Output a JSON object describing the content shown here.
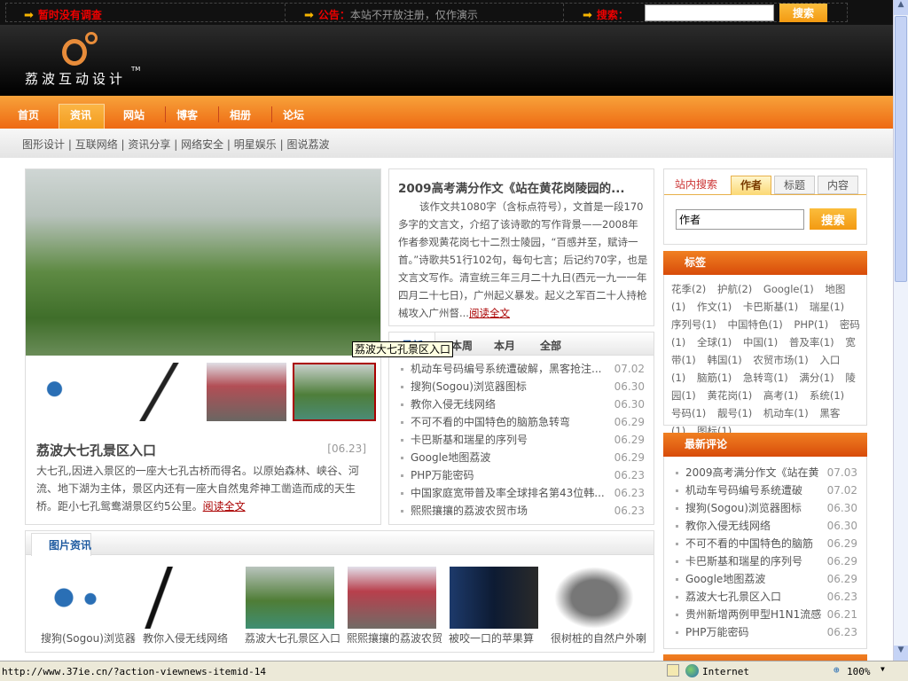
{
  "topbar": {
    "poll": "暂时没有调查",
    "notice_label": "公告：",
    "notice_text": "本站不开放注册，仅作演示",
    "search_label": "搜索：",
    "search_value": "",
    "search_button": "搜索"
  },
  "logo": {
    "text": "荔波互动设计",
    "tm": "TM"
  },
  "nav": [
    "首页",
    "资讯",
    "网站",
    "博客",
    "相册",
    "论坛"
  ],
  "subnav": [
    "图形设计",
    "互联网络",
    "资讯分享",
    "网络安全",
    "明星娱乐",
    "图说荔波"
  ],
  "feature": {
    "title": "荔波大七孔景区入口",
    "date": "[06.23]",
    "text": "大七孔,因进入景区的一座大七孔古桥而得名。以原始森林、峡谷、河流、地下湖为主体，景区内还有一座大自然鬼斧神工凿造而成的天生桥。距小七孔鸳鸯湖景区约5公里。",
    "more": "阅读全文",
    "tooltip": "荔波大七孔景区入口"
  },
  "headline": {
    "title": "2009高考满分作文《站在黄花岗陵园的...",
    "text": "该作文共1080字（含标点符号），文首是一段170多字的文言文，介绍了该诗歌的写作背景——2008年作者参观黄花岗七十二烈士陵园，“百感并至，赋诗一首。”诗歌共51行102句，每句七言；后记约70字，也是文言文写作。清宣统三年三月二十九日(西元一九一一年四月二十七日)，广州起义暴发。起义之军百二十人持枪械攻入广州督...",
    "more": "阅读全文"
  },
  "news_tabs": [
    "最新",
    "本周",
    "本月",
    "全部"
  ],
  "news": [
    [
      "机动车号码编号系统遭破解，黑客抢注...",
      "07.02"
    ],
    [
      "搜狗(Sogou)浏览器图标",
      "06.30"
    ],
    [
      "教你入侵无线网络",
      "06.30"
    ],
    [
      "不可不看的中国特色的脑筋急转弯",
      "06.29"
    ],
    [
      "卡巴斯基和瑞星的序列号",
      "06.29"
    ],
    [
      "Google地图荔波",
      "06.29"
    ],
    [
      "PHP万能密码",
      "06.23"
    ],
    [
      "中国家庭宽带普及率全球排名第43位韩...",
      "06.23"
    ],
    [
      "熙熙攘攘的荔波农贸市场",
      "06.23"
    ]
  ],
  "site_search": {
    "label": "站内搜索",
    "tabs": [
      "作者",
      "标题",
      "内容"
    ],
    "value": "作者",
    "button": "搜索"
  },
  "tags": {
    "title": "标签",
    "items": [
      "花季(2)",
      "护航(2)",
      "Google(1)",
      "地图(1)",
      "作文(1)",
      "卡巴斯基(1)",
      "瑞星(1)",
      "序列号(1)",
      "中国特色(1)",
      "PHP(1)",
      "密码(1)",
      "全球(1)",
      "中国(1)",
      "普及率(1)",
      "宽带(1)",
      "韩国(1)",
      "农贸市场(1)",
      "入口(1)",
      "脑筋(1)",
      "急转弯(1)",
      "满分(1)",
      "陵园(1)",
      "黄花岗(1)",
      "高考(1)",
      "系统(1)",
      "号码(1)",
      "靓号(1)",
      "机动车(1)",
      "黑客(1)",
      "图标(1)"
    ]
  },
  "comments": {
    "title": "最新评论",
    "items": [
      [
        "2009高考满分作文《站在黄",
        "07.03"
      ],
      [
        "机动车号码编号系统遭破",
        "07.02"
      ],
      [
        "搜狗(Sogou)浏览器图标",
        "06.30"
      ],
      [
        "教你入侵无线网络",
        "06.30"
      ],
      [
        "不可不看的中国特色的脑筋",
        "06.29"
      ],
      [
        "卡巴斯基和瑞星的序列号",
        "06.29"
      ],
      [
        "Google地图荔波",
        "06.29"
      ],
      [
        "荔波大七孔景区入口",
        "06.23"
      ],
      [
        "贵州新增两例甲型H1N1流感",
        "06.21"
      ],
      [
        "PHP万能密码",
        "06.23"
      ]
    ]
  },
  "photos": {
    "title": "图片资讯",
    "items": [
      "搜狗(Sogou)浏览器",
      "教你入侵无线网络",
      "荔波大七孔景区入口",
      "熙熙攘攘的荔波农贸",
      "被咬一口的苹果算",
      "很树桩的自然户外喇"
    ]
  },
  "status": {
    "url": "http://www.37ie.cn/?action-viewnews-itemid-14",
    "zone": "Internet",
    "zoom": "100%"
  },
  "colors": {
    "orange": "#ee6a13",
    "red": "#e00",
    "link": "#a00"
  }
}
